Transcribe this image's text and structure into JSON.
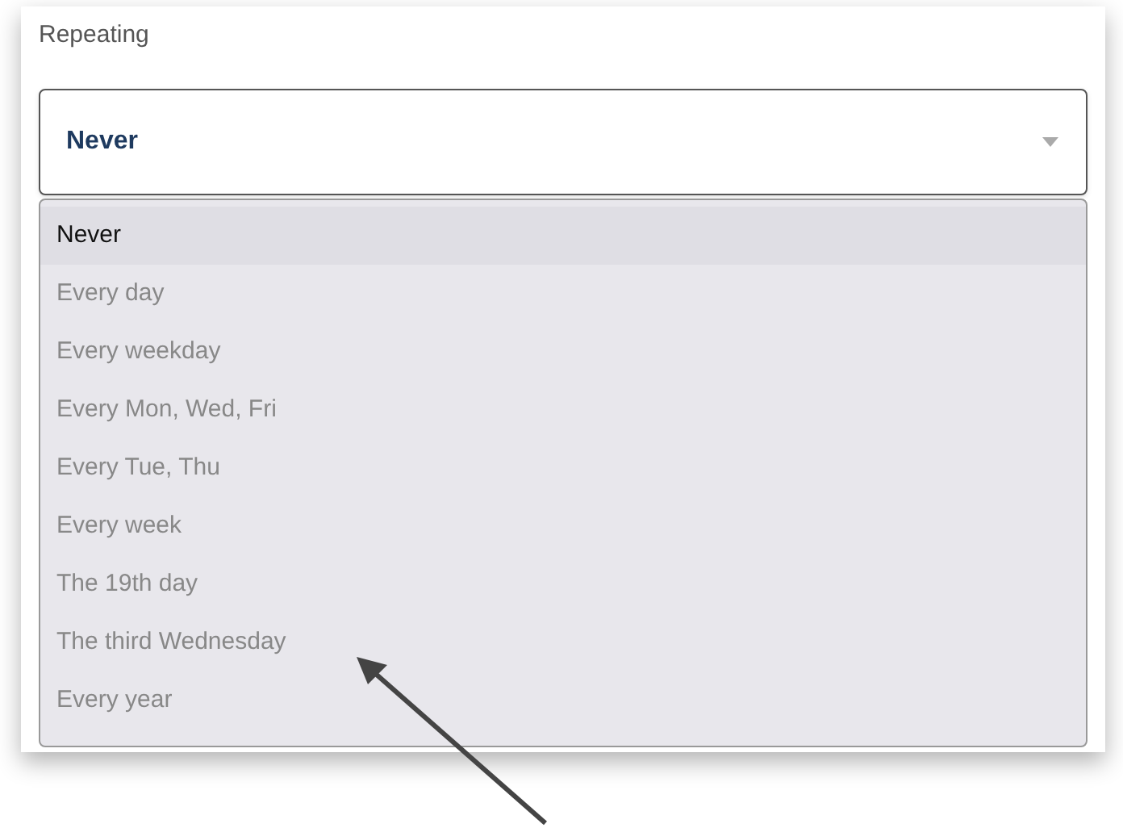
{
  "field": {
    "label": "Repeating",
    "value": "Never",
    "expanded": true
  },
  "options": [
    {
      "label": "Never",
      "selected": true
    },
    {
      "label": "Every day",
      "selected": false
    },
    {
      "label": "Every weekday",
      "selected": false
    },
    {
      "label": "Every Mon, Wed, Fri",
      "selected": false
    },
    {
      "label": "Every Tue, Thu",
      "selected": false
    },
    {
      "label": "Every week",
      "selected": false
    },
    {
      "label": "The 19th day",
      "selected": false
    },
    {
      "label": "The third Wednesday",
      "selected": false
    },
    {
      "label": "Every year",
      "selected": false
    }
  ]
}
